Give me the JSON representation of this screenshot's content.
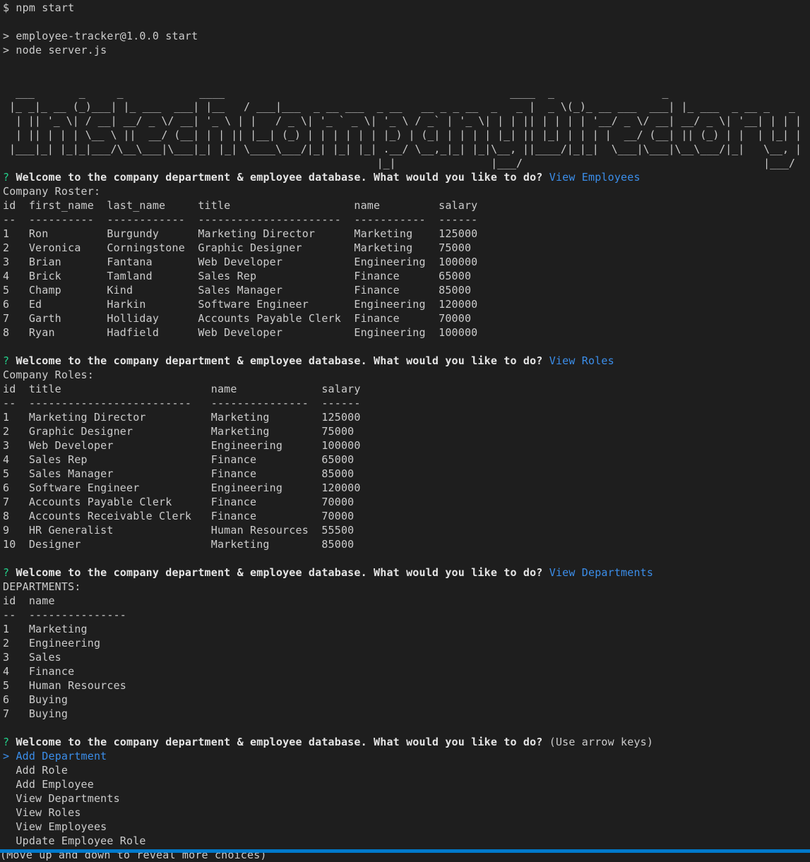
{
  "colors": {
    "background": "#1e1e1e",
    "text": "#cccccc",
    "question_mark": "#23d18b",
    "answer": "#3b8eea",
    "status_bar": "#007acc"
  },
  "terminal": {
    "command": "$ npm start",
    "script_lines": [
      "> employee-tracker@1.0.0 start",
      "> node server.js"
    ],
    "banner_lines": [
      "  ___       _     _            ____                                             ____  _                 _                   ",
      " |_ _|_ __ (_)___| |_ ___  ___| |__   / ___|___  _ __ ___  _ __   __ _ _ __  _   _ |  _ \\(_)_ __ ___  ___| |_ ___  _ __ _   _ ",
      "  | || '_ \\| / __| __/ _ \\/ __| '_ \\ | |   / _ \\| '_ ` _ \\| '_ \\ / _` | '_ \\| | | || | | | | '__/ _ \\/ __| __/ _ \\| '__| | | |",
      "  | || | | | \\__ \\ ||  __/ (__| | | || |__| (_) | | | | | | |_) | (_| | | | | |_| || |_| | | | |  __/ (__| || (_) | |  | |_| |",
      " |___|_| |_|_|___/\\__\\___|\\___|_| |_| \\____\\___/|_| |_| |_| .__/ \\__,_|_| |_|\\__, ||____/|_|_|  \\___|\\___|\\__\\___/|_|   \\__, |",
      "                                                           |_|               |___/                                      |___/ "
    ],
    "prompt_question": "Welcome to the company department & employee database. What would you like to do?",
    "question_mark": "?",
    "selector": ">",
    "sections": {
      "employees": {
        "answer": "View Employees",
        "caption": "Company Roster:",
        "header": "id  first_name  last_name     title                   name         salary",
        "separator": "--  ----------  ------------  ----------------------  -----------  ------",
        "rows": [
          "1   Ron         Burgundy      Marketing Director      Marketing    125000",
          "2   Veronica    Corningstone  Graphic Designer        Marketing    75000",
          "3   Brian       Fantana       Web Developer           Engineering  100000",
          "4   Brick       Tamland       Sales Rep               Finance      65000",
          "5   Champ       Kind          Sales Manager           Finance      85000",
          "6   Ed          Harkin        Software Engineer       Engineering  120000",
          "7   Garth       Holliday      Accounts Payable Clerk  Finance      70000",
          "8   Ryan        Hadfield      Web Developer           Engineering  100000"
        ]
      },
      "roles": {
        "answer": "View Roles",
        "caption": "Company Roles:",
        "header": "id  title                       name             salary",
        "separator": "--  -------------------------   ---------------  ------",
        "rows": [
          "1   Marketing Director          Marketing        125000",
          "2   Graphic Designer            Marketing        75000",
          "3   Web Developer               Engineering      100000",
          "4   Sales Rep                   Finance          65000",
          "5   Sales Manager               Finance          85000",
          "6   Software Engineer           Engineering      120000",
          "7   Accounts Payable Clerk      Finance          70000",
          "8   Accounts Receivable Clerk   Finance          70000",
          "9   HR Generalist               Human Resources  55500",
          "10  Designer                    Marketing        85000"
        ]
      },
      "departments": {
        "answer": "View Departments",
        "caption": "DEPARTMENTS:",
        "header": "id  name",
        "separator": "--  ---------------",
        "rows": [
          "1   Marketing",
          "2   Engineering",
          "3   Sales",
          "4   Finance",
          "5   Human Resources",
          "6   Buying",
          "7   Buying"
        ]
      }
    },
    "menu": {
      "hint": "(Use arrow keys)",
      "options": [
        "Add Department",
        "Add Role",
        "Add Employee",
        "View Departments",
        "View Roles",
        "View Employees",
        "Update Employee Role"
      ],
      "footer": "(Move up and down to reveal more choices)"
    }
  }
}
